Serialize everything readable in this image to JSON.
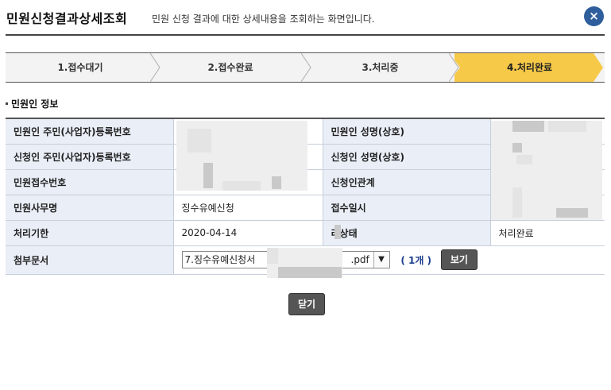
{
  "header": {
    "title": "민원신청결과상세조회",
    "subtitle": "민원 신청 결과에 대한 상세내용을 조회하는 화면입니다.",
    "close_icon": "×"
  },
  "steps": [
    {
      "label": "1.접수대기",
      "active": false
    },
    {
      "label": "2.접수완료",
      "active": false
    },
    {
      "label": "3.처리중",
      "active": false
    },
    {
      "label": "4.처리완료",
      "active": true
    }
  ],
  "section": {
    "title": "민원인 정보"
  },
  "table": {
    "row1": {
      "label_left": "민원인 주민(사업자)등록번호",
      "value_left": "",
      "label_right": "민원인 성명(상호)",
      "value_right": ""
    },
    "row2": {
      "label_left": "신청인 주민(사업자)등록번호",
      "value_left": "",
      "label_right": "신청인 성명(상호)",
      "value_right": ""
    },
    "row3": {
      "label_left": "민원접수번호",
      "value_left": "",
      "label_right": "신청인관계",
      "value_right": ""
    },
    "row4": {
      "label_left": "민원사무명",
      "value_left": "징수유예신청",
      "label_right": "접수일시",
      "value_right": ""
    },
    "row5": {
      "label_left": "처리기한",
      "value_left": "2020-04-14",
      "label_right": "리상태",
      "value_right": "처리완료"
    },
    "row6": {
      "label_left": "첨부문서",
      "file_name": "7.징수유예신청서",
      "file_ext": ".pdf",
      "file_count": "( 1개 )",
      "view_label": "보기"
    }
  },
  "footer": {
    "close_label": "닫기"
  },
  "colors": {
    "accent_step": "#f7c948",
    "header_blue": "#2e5e9c",
    "label_bg": "#e9eef7"
  }
}
